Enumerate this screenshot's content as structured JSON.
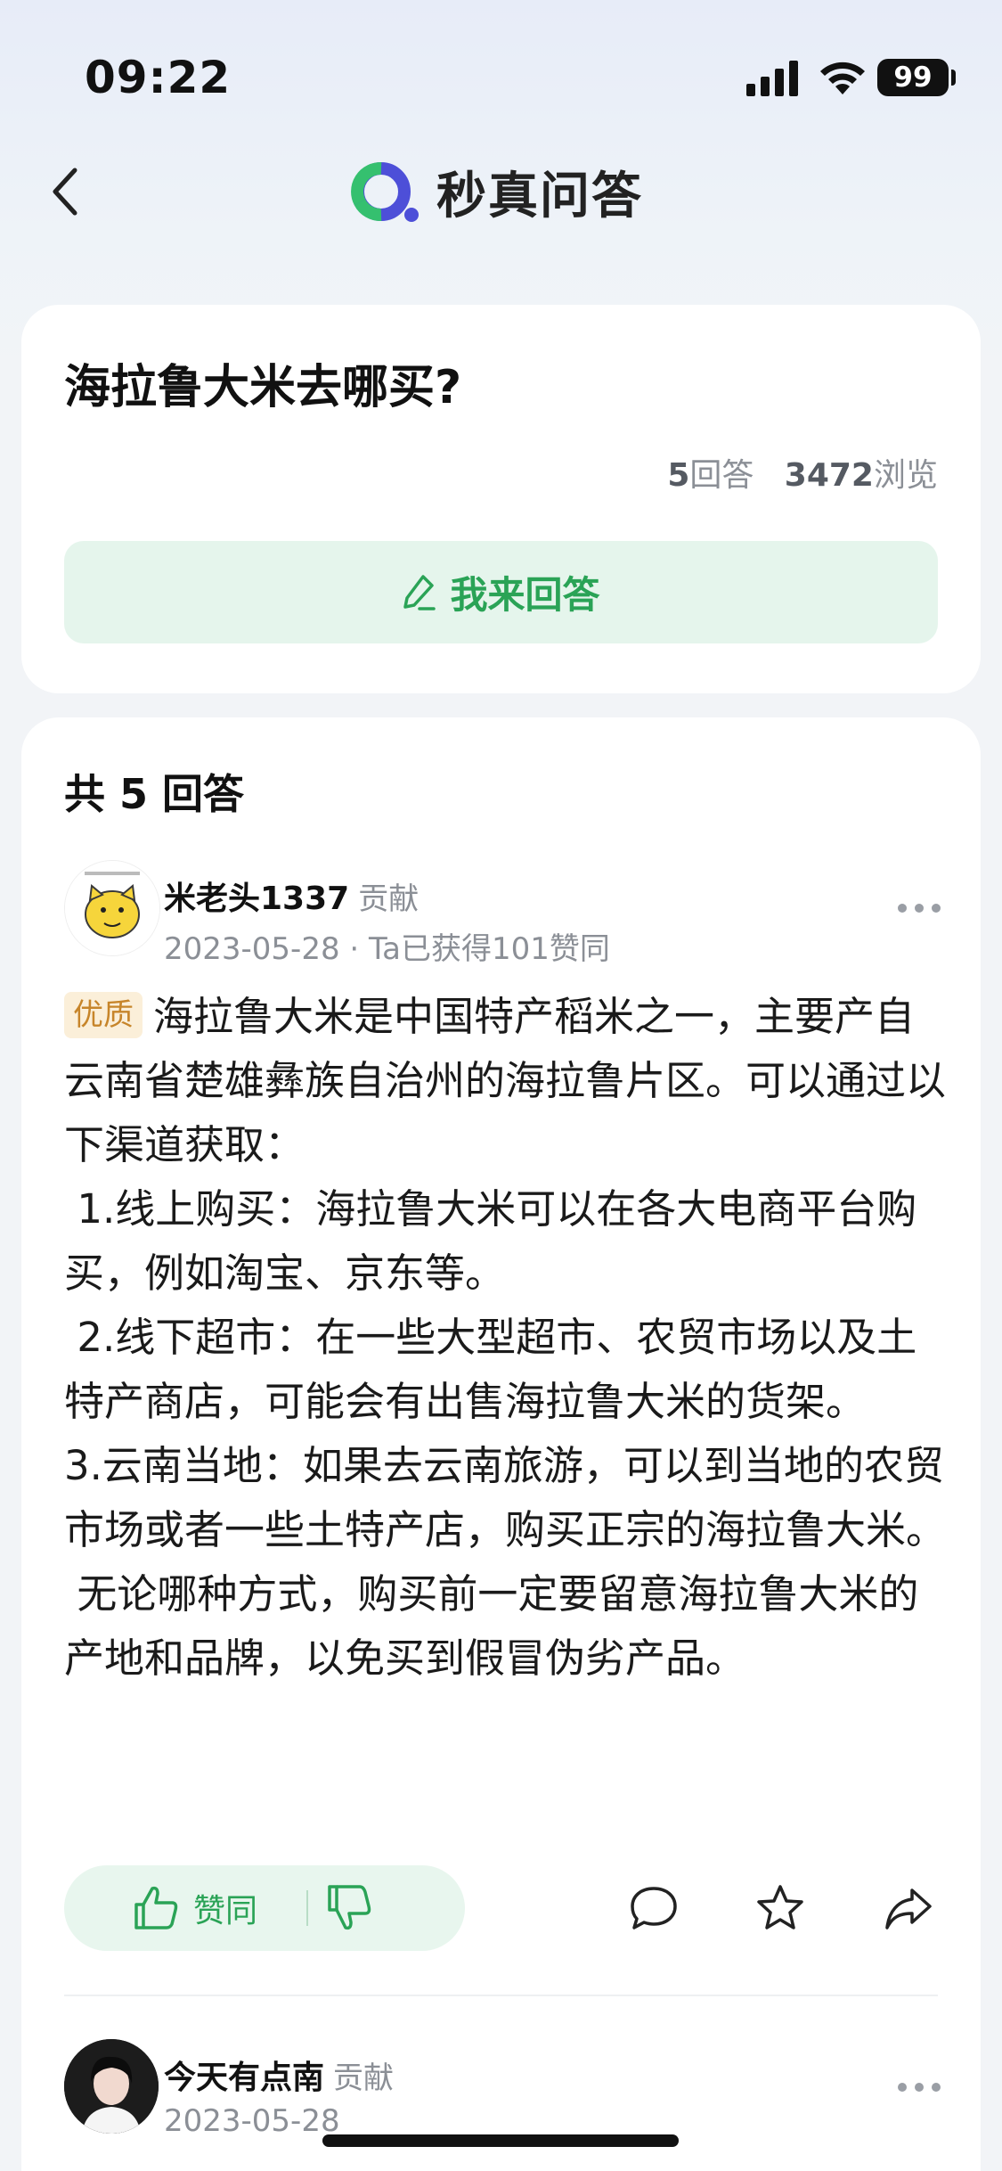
{
  "status_bar": {
    "time": "09:22",
    "battery": "99"
  },
  "nav": {
    "brand_name": "秒真问答"
  },
  "question": {
    "title": "海拉鲁大米去哪买?",
    "answers_count": "5",
    "answers_label": "回答",
    "views_count": "3472",
    "views_label": "浏览",
    "answer_button_label": "我来回答"
  },
  "answers_section": {
    "count_title": "共 5 回答",
    "answers": [
      {
        "author": "米老头1337",
        "author_tag": "贡献",
        "date": "2023-05-28",
        "likes_meta": "Ta已获得101赞同",
        "badge": "优质",
        "paragraphs": [
          "海拉鲁大米是中国特产稻米之一，主要产自云南省楚雄彝族自治州的海拉鲁片区。可以通过以下渠道获取：",
          " 1.线上购买：海拉鲁大米可以在各大电商平台购买，例如淘宝、京东等。",
          " 2.线下超市：在一些大型超市、农贸市场以及土特产商店，可能会有出售海拉鲁大米的货架。",
          "3.云南当地：如果去云南旅游，可以到当地的农贸市场或者一些土特产店，购买正宗的海拉鲁大米。",
          " 无论哪种方式，购买前一定要留意海拉鲁大米的产地和品牌，以免买到假冒伪劣产品。"
        ],
        "like_label": "赞同"
      },
      {
        "author": "今天有点南",
        "author_tag": "贡献",
        "date": "2023-05-28"
      }
    ]
  },
  "colors": {
    "accent_green": "#2aa356",
    "pill_bg": "#e8f6ee",
    "badge_bg": "#fbefd9",
    "badge_text": "#c7852a"
  }
}
